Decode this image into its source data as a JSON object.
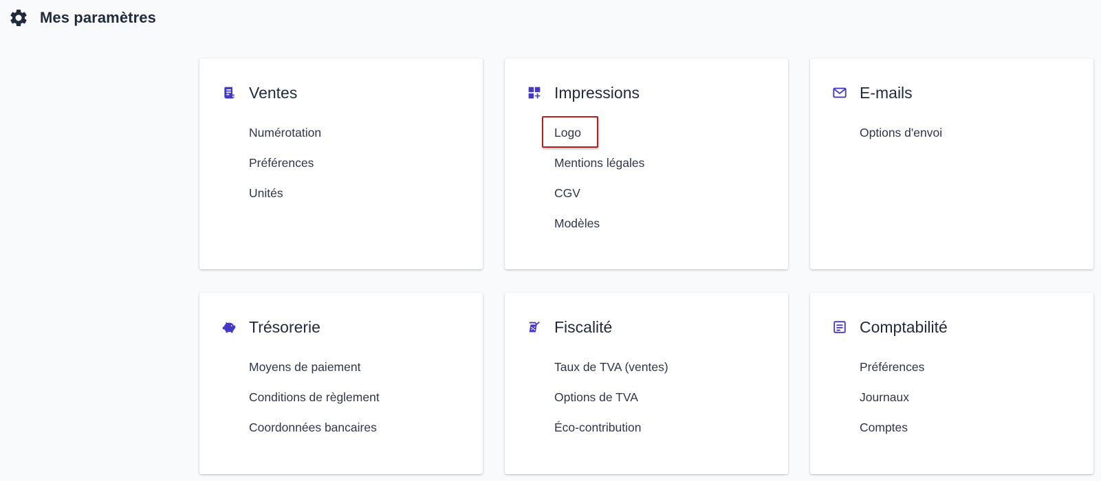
{
  "header": {
    "title": "Mes paramètres",
    "icon": "gear-icon"
  },
  "colors": {
    "accent": "#4338ca",
    "highlight_border": "#b91c1c",
    "heading": "#1f2a3d"
  },
  "cards": [
    {
      "title": "Ventes",
      "icon": "receipt-icon",
      "links": [
        "Numérotation",
        "Préférences",
        "Unités"
      ]
    },
    {
      "title": "Impressions",
      "icon": "dashboard-add-icon",
      "links": [
        "Logo",
        "Mentions légales",
        "CGV",
        "Modèles"
      ],
      "highlighted_link": "Logo"
    },
    {
      "title": "E-mails",
      "icon": "mail-icon",
      "links": [
        "Options d'envoi"
      ]
    },
    {
      "title": "Trésorerie",
      "icon": "piggy-bank-icon",
      "links": [
        "Moyens de paiement",
        "Conditions de règlement",
        "Coordonnées bancaires"
      ]
    },
    {
      "title": "Fiscalité",
      "icon": "tax-document-icon",
      "links": [
        "Taux de TVA (ventes)",
        "Options de TVA",
        "Éco-contribution"
      ]
    },
    {
      "title": "Comptabilité",
      "icon": "ledger-icon",
      "links": [
        "Préférences",
        "Journaux",
        "Comptes"
      ]
    }
  ]
}
